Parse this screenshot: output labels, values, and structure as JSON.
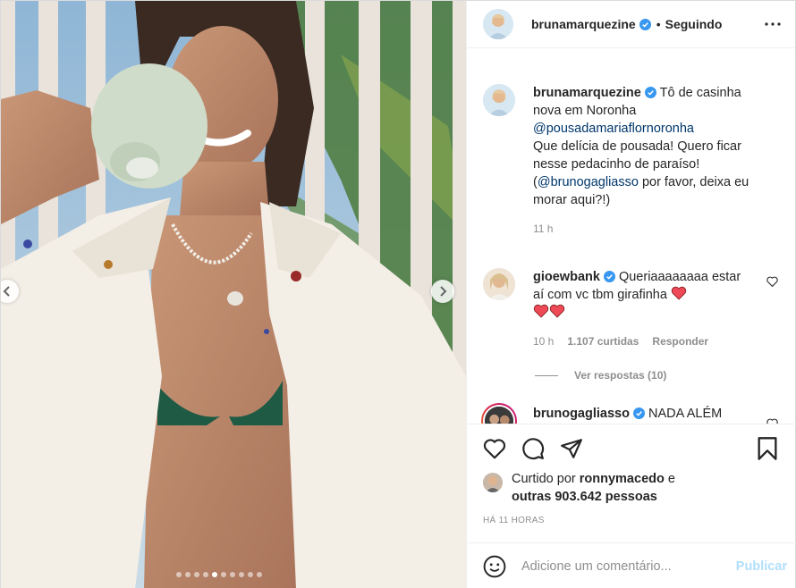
{
  "header": {
    "username": "brunamarquezine",
    "separator": "•",
    "follow_status": "Seguindo"
  },
  "caption": {
    "username": "brunamarquezine",
    "line1": "Tô de casinha nova em Noronha",
    "mention": "@pousadamariaflornoronha",
    "line2": "Que delícia de pousada! Quero ficar nesse pedacinho de paraíso!",
    "open_paren": "(",
    "mention2": "@brunogagliasso",
    "line3": " por favor, deixa eu morar aqui?!)",
    "time": "11 h"
  },
  "comments": [
    {
      "username": "gioewbank",
      "text": "Queriaaaaaaaa estar aí com vc tbm girafinha",
      "time": "10 h",
      "likes": "1.107 curtidas",
      "reply": "Responder",
      "view_replies": "Ver respostas (10)"
    },
    {
      "username": "brunogagliasso",
      "text": "NADA ALÉM"
    }
  ],
  "likes": {
    "prefix": "Curtido por",
    "liker": "ronnymacedo",
    "conj": "e",
    "others": "outras 903.642 pessoas"
  },
  "posted": "HÁ 11 HORAS",
  "add_comment": {
    "placeholder": "Adicione um comentário...",
    "publish": "Publicar"
  },
  "carousel": {
    "total": 10,
    "current": 4
  },
  "colors": {
    "verified": "#3897f0",
    "link": "#00376b",
    "muted": "#8e8e8e",
    "publish_disabled": "#b2dffc",
    "heart": "#ed4956"
  },
  "icons": [
    "more-icon",
    "heart-icon",
    "comment-icon",
    "share-icon",
    "bookmark-icon",
    "emoji-icon",
    "verified-icon",
    "chevron-left-icon",
    "chevron-right-icon"
  ]
}
